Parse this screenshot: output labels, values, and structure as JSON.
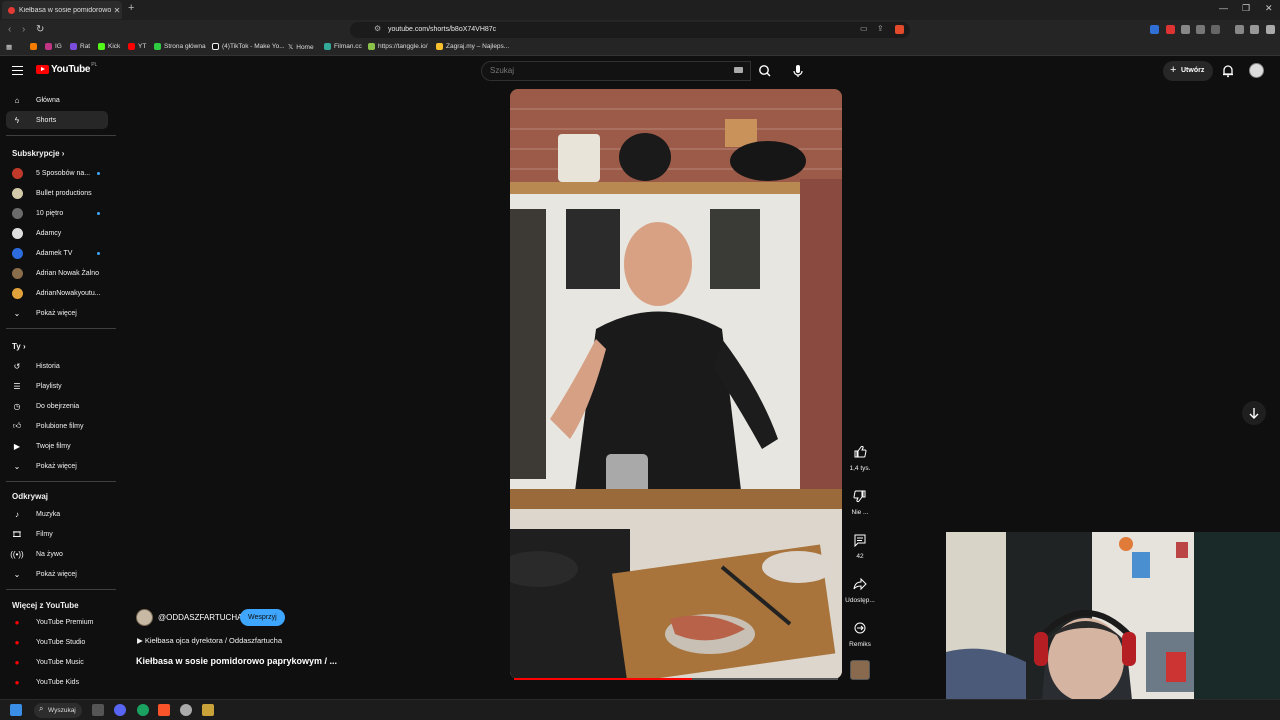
{
  "browser": {
    "tab_title": "Kiełbasa w sosie pomidorowo",
    "url": "youtube.com/shorts/b8oX74VH87c",
    "bookmarks": [
      "IG",
      "Rat",
      "Kick",
      "YT",
      "Strona główna",
      "(4)TikTok - Make Yo...",
      "Home",
      "Filman.cc",
      "https://tanggle.io/",
      "Zagraj.my – Najleps..."
    ]
  },
  "header": {
    "logo_text": "YouTube",
    "logo_country": "PL",
    "search_placeholder": "Szukaj",
    "create_label": "Utwórz"
  },
  "sidebar": {
    "main": [
      {
        "label": "Główna",
        "icon": "home-icon"
      },
      {
        "label": "Shorts",
        "icon": "shorts-icon"
      }
    ],
    "subscriptions_heading": "Subskrypcje",
    "subscriptions": [
      {
        "label": "5 Sposobów na...",
        "color": "#c0392b",
        "new": true
      },
      {
        "label": "Bullet productions",
        "color": "#d4c9a8",
        "new": false
      },
      {
        "label": "10 piętro",
        "color": "#6b6b6b",
        "new": true
      },
      {
        "label": "Adamcy",
        "color": "#e0e0e0",
        "new": false
      },
      {
        "label": "Adamek TV",
        "color": "#2d6cdf",
        "new": true
      },
      {
        "label": "Adrian Nowak Żalno",
        "color": "#8a6d4b",
        "new": false
      },
      {
        "label": "AdrianNowakyoutu...",
        "color": "#e2a23b",
        "new": false
      }
    ],
    "subs_more": "Pokaż więcej",
    "you_heading": "Ty",
    "you": [
      {
        "label": "Historia",
        "icon": "history-icon"
      },
      {
        "label": "Playlisty",
        "icon": "playlist-icon"
      },
      {
        "label": "Do obejrzenia",
        "icon": "watch-later-icon"
      },
      {
        "label": "Polubione filmy",
        "icon": "like-icon"
      },
      {
        "label": "Twoje filmy",
        "icon": "your-videos-icon"
      }
    ],
    "you_more": "Pokaż więcej",
    "explore_heading": "Odkrywaj",
    "explore": [
      {
        "label": "Muzyka",
        "icon": "music-icon"
      },
      {
        "label": "Filmy",
        "icon": "movies-icon"
      },
      {
        "label": "Na żywo",
        "icon": "live-icon"
      }
    ],
    "explore_more": "Pokaż więcej",
    "more_heading": "Więcej z YouTube",
    "more": [
      {
        "label": "YouTube Premium"
      },
      {
        "label": "YouTube Studio"
      },
      {
        "label": "YouTube Music"
      },
      {
        "label": "YouTube Kids"
      }
    ]
  },
  "short": {
    "channel": "@ODDASZFARTUCHA",
    "support_label": "Wesprzyj",
    "playlist": "▶ Kiełbasa ojca dyrektora / Oddaszfartucha",
    "title": "Kiełbasa w sosie pomidorowo paprykowym / ...",
    "progress": 0.55,
    "actions": {
      "likes": "1,4 tys.",
      "dislike": "Nie ...",
      "comments": "42",
      "share": "Udostęp...",
      "remix": "Remiks"
    }
  },
  "taskbar": {
    "search_label": "Wyszukaj"
  }
}
